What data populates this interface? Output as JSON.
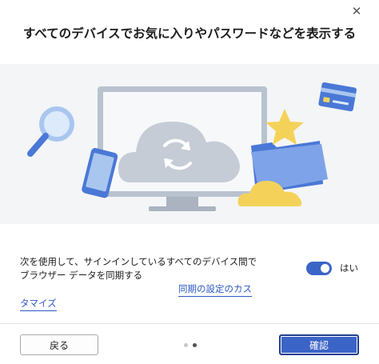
{
  "dialog": {
    "close_glyph": "✕",
    "title": "すべてのデバイスでお気に入りやパスワードなどを表示する"
  },
  "illustration": {
    "icons": [
      "magnifier-icon",
      "monitor-icon",
      "cloud-sync-icon",
      "phone-icon",
      "credit-card-icon",
      "star-icon",
      "folder-icon",
      "small-cloud-icon"
    ],
    "colors": {
      "background": "#f3f5f7",
      "monitor_frame": "#b9c3cf",
      "cloud": "#c5ccd6",
      "blue": "#4a78d6",
      "light_blue": "#a9c6ee",
      "yellow": "#f4d25a"
    }
  },
  "sync": {
    "description_line1": "次を使用して、サインインしているすべてのデバイス間で",
    "description_line2": "ブラウザー データを同期する",
    "toggle_state": true,
    "toggle_label": "はい",
    "settings_link": "同期の設定のカス",
    "customize_link": "タマイズ"
  },
  "footer": {
    "back_label": "戻る",
    "confirm_label": "確認",
    "pager": {
      "total": 2,
      "current": 2
    }
  },
  "colors": {
    "accent": "#3b64c7",
    "link": "#2b59c3"
  }
}
